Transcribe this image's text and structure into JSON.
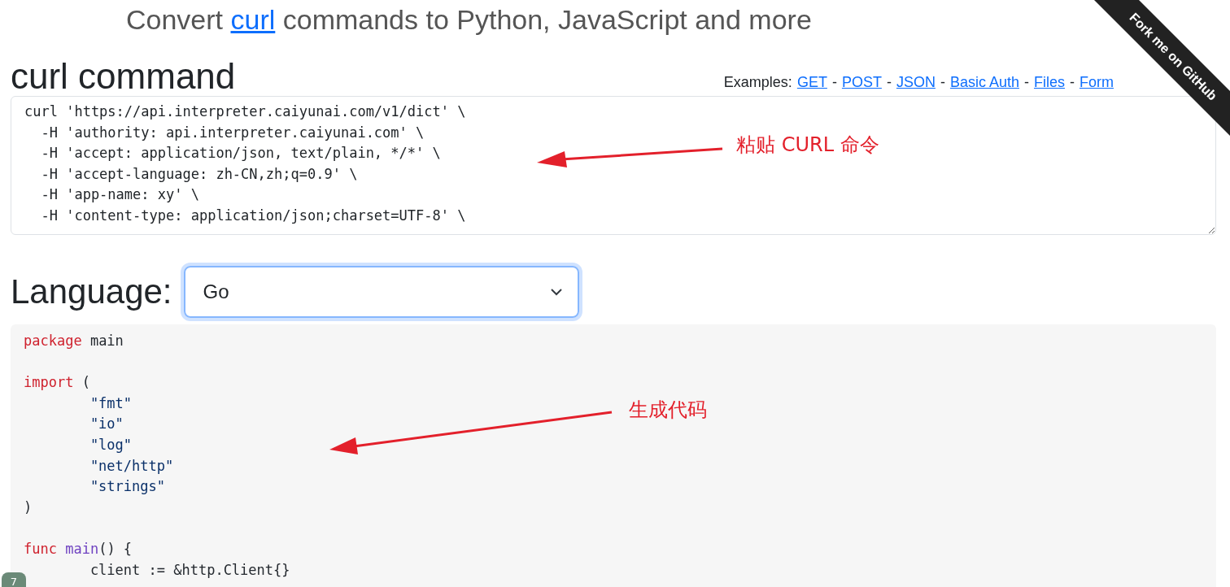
{
  "title": {
    "before": "Convert ",
    "link": "curl",
    "after": " commands to Python, JavaScript and more"
  },
  "ribbon": "Fork me on GitHub",
  "curl_section": {
    "heading": "curl command",
    "examples_label": "Examples:",
    "examples": [
      "GET",
      "POST",
      "JSON",
      "Basic Auth",
      "Files",
      "Form"
    ],
    "separator": "-",
    "lines": [
      "curl 'https://api.interpreter.caiyunai.com/v1/dict' \\",
      "  -H 'authority: api.interpreter.caiyunai.com' \\",
      "  -H 'accept: application/json, text/plain, */*' \\",
      "  -H 'accept-language: zh-CN,zh;q=0.9' \\",
      "  -H 'app-name: xy' \\",
      "  -H 'content-type: application/json;charset=UTF-8' \\"
    ]
  },
  "language": {
    "label": "Language:",
    "value": "Go"
  },
  "code_blocks": [
    [
      [
        {
          "kind": "keyword",
          "text": "package"
        },
        {
          "kind": "plain",
          "text": " main"
        }
      ]
    ],
    [
      [
        {
          "kind": "keyword",
          "text": "import"
        },
        {
          "kind": "plain",
          "text": " ("
        }
      ],
      [
        {
          "kind": "string",
          "text": "        \"fmt\""
        }
      ],
      [
        {
          "kind": "string",
          "text": "        \"io\""
        }
      ],
      [
        {
          "kind": "string",
          "text": "        \"log\""
        }
      ],
      [
        {
          "kind": "string",
          "text": "        \"net/http\""
        }
      ],
      [
        {
          "kind": "string",
          "text": "        \"strings\""
        }
      ],
      [
        {
          "kind": "plain",
          "text": ")"
        }
      ]
    ],
    [
      [
        {
          "kind": "keyword",
          "text": "func "
        },
        {
          "kind": "function",
          "text": "main"
        },
        {
          "kind": "plain",
          "text": "() {"
        }
      ],
      [
        {
          "kind": "plain",
          "text": "        client := &http.Client{}"
        }
      ]
    ]
  ],
  "annotations": [
    {
      "text": "粘贴 CURL 命令"
    },
    {
      "text": "生成代码"
    }
  ],
  "corner_badge": "7"
}
